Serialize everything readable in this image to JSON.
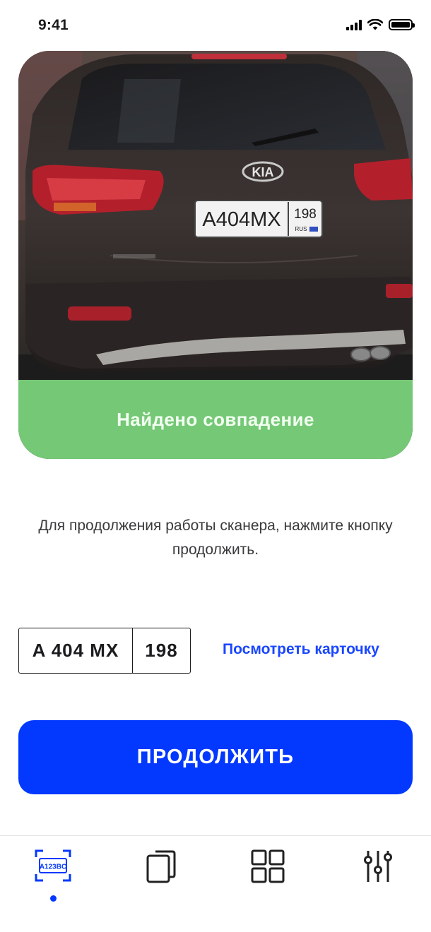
{
  "status_bar": {
    "time": "9:41"
  },
  "photo": {
    "plate_text": "А404МХ",
    "plate_region": "198",
    "plate_country": "RUS",
    "car_brand": "KIA"
  },
  "match": {
    "text": "Найдено совпадение",
    "color": "#75c875"
  },
  "hint": {
    "text": "Для продолжения работы сканера, нажмите кнопку продолжить."
  },
  "plate": {
    "main": "A 404 MX",
    "region": "198"
  },
  "actions": {
    "view_card": "Посмотреть карточку",
    "continue": "ПРОДОЛЖИТЬ"
  },
  "tab_bar": {
    "active_index": 0,
    "tabs": [
      {
        "icon": "plate-scanner-icon",
        "text": "A123BC"
      },
      {
        "icon": "copy-documents-icon"
      },
      {
        "icon": "grid-icon"
      },
      {
        "icon": "sliders-icon"
      }
    ]
  },
  "colors": {
    "accent": "#0338ff",
    "link": "#1946ff",
    "match_green": "#75c875"
  }
}
